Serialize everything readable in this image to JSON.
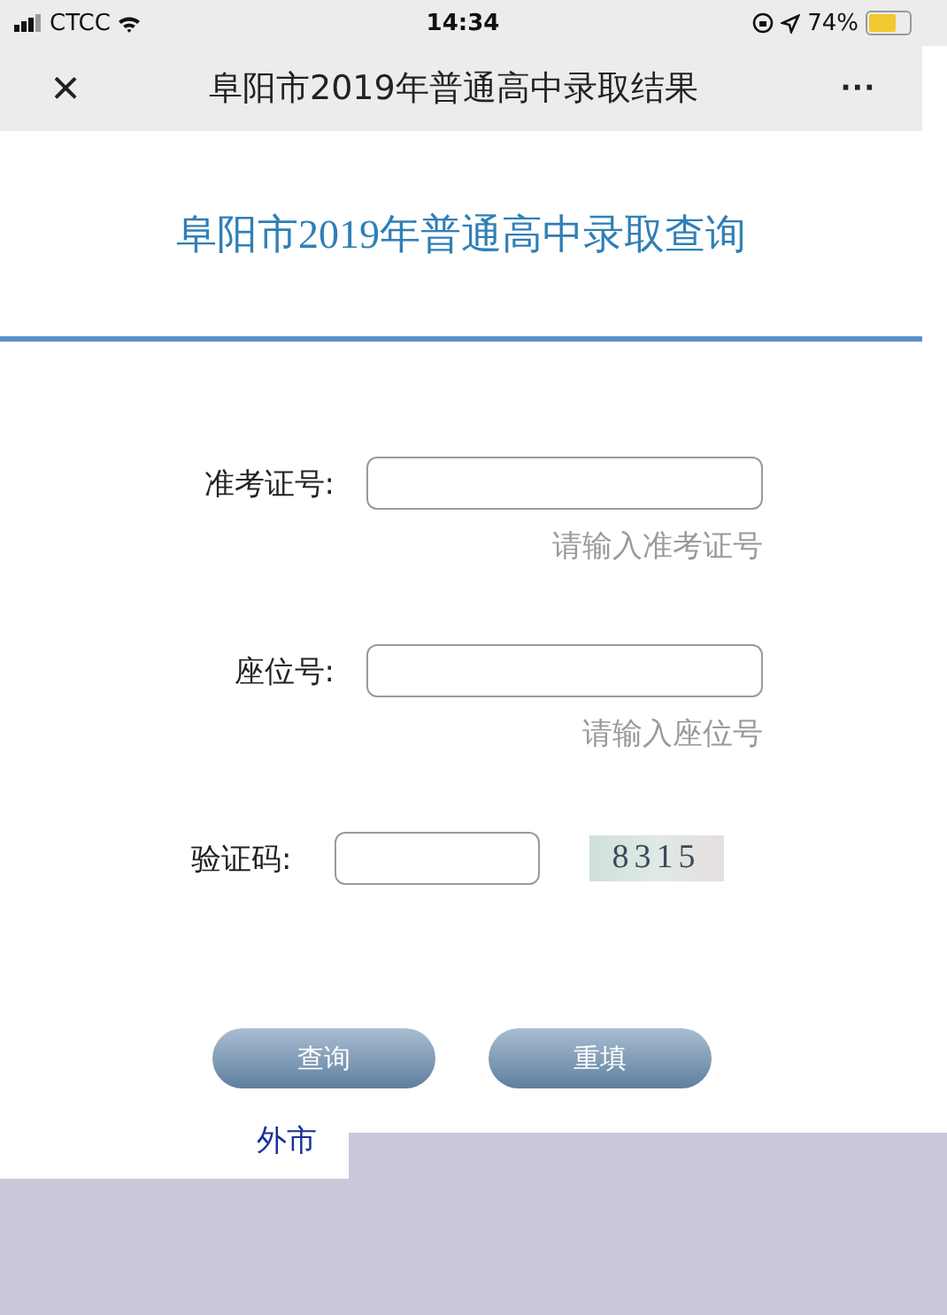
{
  "status_bar": {
    "carrier": "CTCC",
    "time": "14:34",
    "battery": "74%"
  },
  "nav_bar": {
    "close": "×",
    "title": "阜阳市2019年普通高中录取结果",
    "more": "···"
  },
  "heading": "阜阳市2019年普通高中录取查询",
  "form": [
    {
      "kind": "text",
      "label": "准考证号:",
      "placeholder": "请输入准考证号"
    },
    {
      "kind": "text",
      "label": "座位号:",
      "placeholder": "请输入座位号"
    },
    {
      "kind": "captcha",
      "label": "验证码:",
      "captcha": "8315"
    }
  ],
  "buttons": [
    "查询",
    "重填"
  ],
  "footer_link": "外市"
}
